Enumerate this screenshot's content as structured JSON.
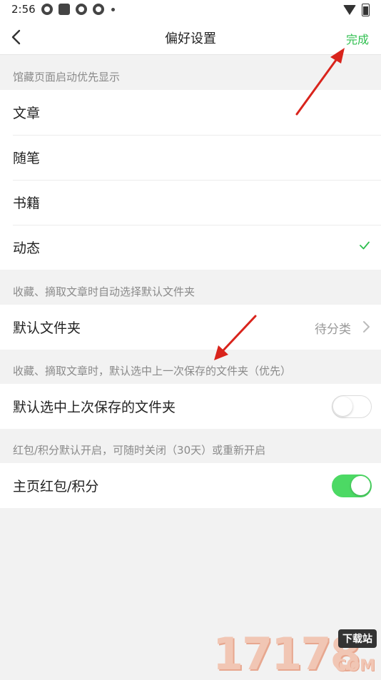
{
  "status_bar": {
    "time": "2:56"
  },
  "nav": {
    "title": "偏好设置",
    "done_label": "完成"
  },
  "section_startup": {
    "header": "馆藏页面启动优先显示",
    "options": [
      {
        "label": "文章"
      },
      {
        "label": "随笔"
      },
      {
        "label": "书籍"
      },
      {
        "label": "动态"
      }
    ],
    "selected": "动态"
  },
  "section_default_folder": {
    "header": "收藏、摘取文章时自动选择默认文件夹",
    "row_label": "默认文件夹",
    "row_value": "待分类"
  },
  "section_last_folder": {
    "header": "收藏、摘取文章时，默认选中上一次保存的文件夹（优先）",
    "row_label": "默认选中上次保存的文件夹",
    "toggle_on": false
  },
  "section_redpacket": {
    "header": "红包/积分默认开启，可随时关闭（30天）或重新开启",
    "row_label": "主页红包/积分",
    "toggle_on": true
  },
  "watermark": {
    "digits": "17178",
    "tag": "下载站",
    "suffix": "COM"
  },
  "colors": {
    "accent_green": "#2fbf4f",
    "toggle_on": "#4cd964",
    "annotation_red": "#d9241c"
  }
}
